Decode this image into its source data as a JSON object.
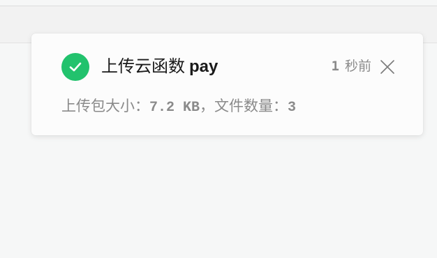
{
  "notification": {
    "status": "success",
    "icon": "check-circle-icon",
    "title_prefix": "上传云函数",
    "function_name": "pay",
    "time_value": "1",
    "time_unit": "秒前",
    "close_icon": "close-icon",
    "detail_size_label": "上传包大小：",
    "detail_size_value": "7.2 KB",
    "detail_separator": "，",
    "detail_count_label": "文件数量：",
    "detail_count_value": "3",
    "accent_color": "#22c26d"
  }
}
